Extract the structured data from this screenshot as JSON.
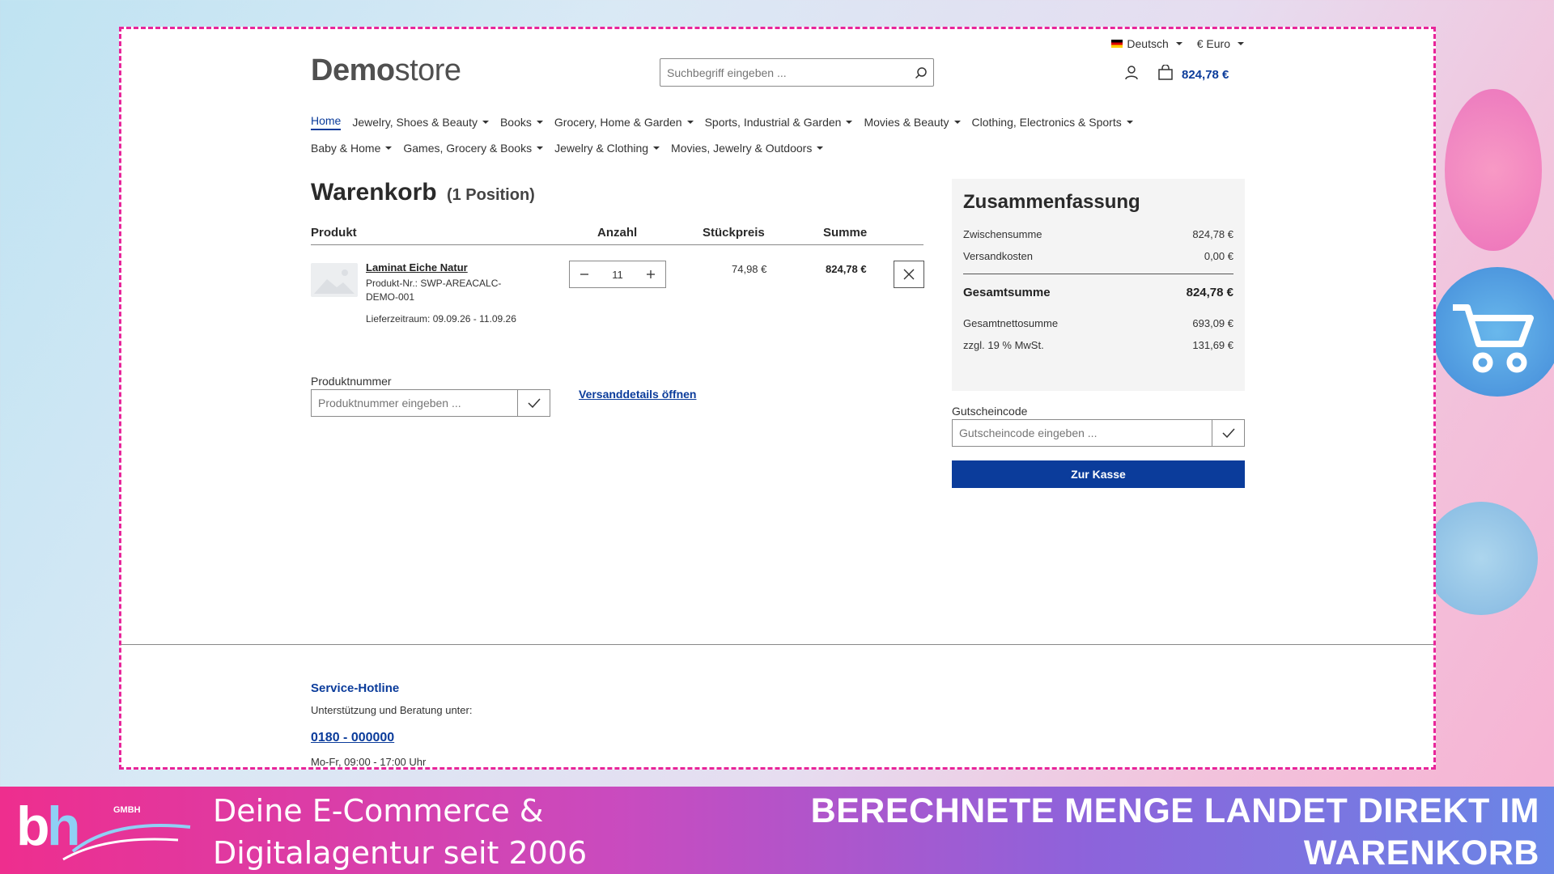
{
  "topbar": {
    "language": "Deutsch",
    "currency": "€ Euro"
  },
  "logo": {
    "bold": "Demo",
    "light": "store"
  },
  "search": {
    "placeholder": "Suchbegriff eingeben ..."
  },
  "header": {
    "cart_total": "824,78 €"
  },
  "nav": {
    "row1": [
      "Home",
      "Jewelry, Shoes & Beauty",
      "Books",
      "Grocery, Home & Garden",
      "Sports, Industrial & Garden",
      "Movies & Beauty",
      "Clothing, Electronics & Sports"
    ],
    "row2": [
      "Baby & Home",
      "Games, Grocery & Books",
      "Jewelry & Clothing",
      "Movies, Jewelry & Outdoors"
    ]
  },
  "cart": {
    "title": "Warenkorb",
    "count": "(1 Position)",
    "columns": {
      "product": "Produkt",
      "quantity": "Anzahl",
      "unit_price": "Stückpreis",
      "total": "Summe"
    },
    "item": {
      "name": "Laminat Eiche Natur",
      "sku": "Produkt-Nr.: SWP-AREACALC-DEMO-001",
      "delivery": "Lieferzeitraum: 09.09.26 - 11.09.26",
      "quantity": "11",
      "unit_price": "74,98 €",
      "total": "824,78 €"
    },
    "product_number": {
      "label": "Produktnummer",
      "placeholder": "Produktnummer eingeben ..."
    },
    "shipping_link": "Versanddetails öffnen"
  },
  "summary": {
    "title": "Zusammenfassung",
    "subtotal_label": "Zwischensumme",
    "subtotal": "824,78 €",
    "shipping_label": "Versandkosten",
    "shipping": "0,00 €",
    "grand_label": "Gesamtsumme",
    "grand": "824,78 €",
    "net_label": "Gesamtnettosumme",
    "net": "693,09 €",
    "vat_label": "zzgl. 19 % MwSt.",
    "vat": "131,69 €"
  },
  "voucher": {
    "label": "Gutscheincode",
    "placeholder": "Gutscheincode eingeben ..."
  },
  "checkout": {
    "label": "Zur Kasse"
  },
  "footer": {
    "hotline_title": "Service-Hotline",
    "hotline_sub": "Unterstützung und Beratung unter:",
    "phone": "0180 - 000000",
    "hours": "Mo-Fr, 09:00 - 17:00 Uhr"
  },
  "banner": {
    "logo_text": "bh GMBH",
    "tagline_1": "Deine E-Commerce &",
    "tagline_2": "Digitalagentur seit 2006",
    "headline_1": "BERECHNETE MENGE LANDET DIREKT IM",
    "headline_2": "WARENKORB"
  },
  "colors": {
    "brand_blue": "#0b3c9b",
    "frame_dash": "#e8259a"
  }
}
